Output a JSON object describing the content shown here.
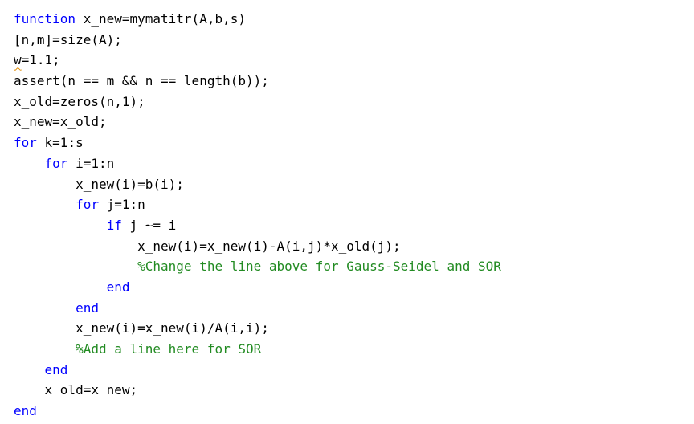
{
  "editor": {
    "language": "MATLAB",
    "colors": {
      "keyword": "#0000ff",
      "comment": "#228b22",
      "text": "#000000",
      "warning": "#e08a00"
    },
    "lines": [
      {
        "indent": "",
        "tokens": [
          {
            "t": "kw",
            "v": "function"
          },
          {
            "t": "tx",
            "v": " x_new=mymatitr(A,b,s)"
          }
        ]
      },
      {
        "indent": "",
        "tokens": [
          {
            "t": "tx",
            "v": "[n,m]=size(A);"
          }
        ]
      },
      {
        "indent": "",
        "tokens": [
          {
            "t": "warn",
            "v": "w"
          },
          {
            "t": "tx",
            "v": "=1.1;"
          }
        ]
      },
      {
        "indent": "",
        "tokens": [
          {
            "t": "tx",
            "v": "assert(n == m && n == length(b));"
          }
        ]
      },
      {
        "indent": "",
        "tokens": [
          {
            "t": "tx",
            "v": "x_old=zeros(n,1);"
          }
        ]
      },
      {
        "indent": "",
        "tokens": [
          {
            "t": "tx",
            "v": "x_new=x_old;"
          }
        ]
      },
      {
        "indent": "",
        "tokens": [
          {
            "t": "kw",
            "v": "for"
          },
          {
            "t": "tx",
            "v": " k=1:s"
          }
        ]
      },
      {
        "indent": "    ",
        "tokens": [
          {
            "t": "kw",
            "v": "for"
          },
          {
            "t": "tx",
            "v": " i=1:n"
          }
        ]
      },
      {
        "indent": "        ",
        "tokens": [
          {
            "t": "tx",
            "v": "x_new(i)=b(i);"
          }
        ]
      },
      {
        "indent": "        ",
        "tokens": [
          {
            "t": "kw",
            "v": "for"
          },
          {
            "t": "tx",
            "v": " j=1:n"
          }
        ]
      },
      {
        "indent": "            ",
        "tokens": [
          {
            "t": "kw",
            "v": "if"
          },
          {
            "t": "tx",
            "v": " j ~= i"
          }
        ]
      },
      {
        "indent": "                ",
        "tokens": [
          {
            "t": "tx",
            "v": "x_new(i)=x_new(i)-A(i,j)*x_old(j);"
          }
        ]
      },
      {
        "indent": "                ",
        "tokens": [
          {
            "t": "cm",
            "v": "%Change the line above for Gauss-Seidel and SOR"
          }
        ]
      },
      {
        "indent": "            ",
        "tokens": [
          {
            "t": "kw",
            "v": "end"
          }
        ]
      },
      {
        "indent": "        ",
        "tokens": [
          {
            "t": "kw",
            "v": "end"
          }
        ]
      },
      {
        "indent": "        ",
        "tokens": [
          {
            "t": "tx",
            "v": "x_new(i)=x_new(i)/A(i,i);"
          }
        ]
      },
      {
        "indent": "        ",
        "tokens": [
          {
            "t": "cm",
            "v": "%Add a line here for SOR"
          }
        ]
      },
      {
        "indent": "    ",
        "tokens": [
          {
            "t": "kw",
            "v": "end"
          }
        ]
      },
      {
        "indent": "    ",
        "tokens": [
          {
            "t": "tx",
            "v": "x_old=x_new;"
          }
        ]
      },
      {
        "indent": "",
        "tokens": [
          {
            "t": "kw",
            "v": "end"
          }
        ]
      }
    ]
  }
}
